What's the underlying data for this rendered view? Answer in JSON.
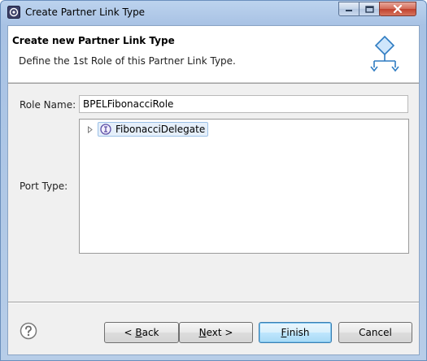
{
  "window": {
    "title": "Create Partner Link Type",
    "controls": {
      "minimize": "minimize",
      "maximize": "maximize",
      "close": "close"
    }
  },
  "banner": {
    "title": "Create new Partner Link Type",
    "description": "Define the 1st Role of this Partner Link Type."
  },
  "form": {
    "role_name_label": "Role Name:",
    "role_name_value": "BPELFibonacciRole",
    "port_type_label": "Port Type:",
    "port_types": [
      {
        "label": "FibonacciDelegate",
        "icon": "interface-icon",
        "selected": true,
        "expanded": false
      }
    ]
  },
  "buttons": {
    "back": {
      "prefix": "< ",
      "mnemonic": "B",
      "rest": "ack"
    },
    "next": {
      "mnemonic": "N",
      "rest": "ext >"
    },
    "finish": {
      "mnemonic": "F",
      "rest": "inish"
    },
    "cancel": "Cancel"
  },
  "colors": {
    "title_gradient": "#bcd3ee",
    "selection_fill": "#e5effa",
    "default_button_border": "#3c7fb1",
    "interface_icon": "#5c4fa6"
  }
}
